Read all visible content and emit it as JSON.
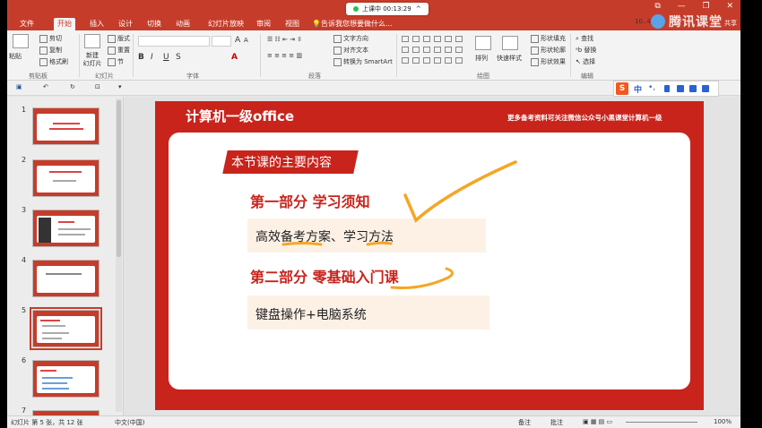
{
  "tabs": [
    "文件",
    "开始",
    "插入",
    "设计",
    "切换",
    "动画",
    "幻灯片放映",
    "审阅",
    "视图"
  ],
  "tell_me": "告诉我您想要做什么...",
  "recording": {
    "label": "上课中 00:13:29",
    "chevron": "^"
  },
  "window_controls": [
    "⧉",
    "—",
    "❐",
    "✕"
  ],
  "share_label": "共享",
  "tencent": {
    "brand": "腾讯课堂",
    "account": "10..41"
  },
  "ribbon": {
    "clipboard": {
      "paste": "粘贴",
      "cut": "剪切",
      "copy": "复制",
      "format_painter": "格式刷",
      "group": "剪贴板"
    },
    "slides": {
      "new_slide": "新建\n幻灯片",
      "layout": "版式",
      "reset": "重置",
      "section": "节",
      "group": "幻灯片"
    },
    "font": {
      "bold": "B",
      "italic": "I",
      "underline": "U",
      "strike": "S",
      "group": "字体",
      "grow": "A",
      "shrink": "A"
    },
    "paragraph": {
      "text_direction": "文字方向",
      "align_text": "对齐文本",
      "smartart": "转换为 SmartArt",
      "group": "段落"
    },
    "drawing": {
      "arrange": "排列",
      "quick_styles": "快速样式",
      "fill": "形状填充",
      "outline": "形状轮廓",
      "effects": "形状效果",
      "group": "绘图"
    },
    "editing": {
      "find": "查找",
      "replace": "替换",
      "select": "选择",
      "group": "编辑"
    }
  },
  "thumbnails": [
    {
      "num": "1",
      "selected": false
    },
    {
      "num": "2",
      "selected": false
    },
    {
      "num": "3",
      "selected": false
    },
    {
      "num": "4",
      "selected": false
    },
    {
      "num": "5",
      "selected": true
    },
    {
      "num": "6",
      "selected": false
    },
    {
      "num": "7",
      "selected": false
    }
  ],
  "slide": {
    "title": "计算机一级office",
    "note": "更多备考资料可关注微信公众号小黑课堂计算机一级",
    "tag": "本节课的主要内容",
    "part1": "第一部分  学习须知",
    "item1": "高效备考方案、学习方法",
    "part2": "第二部分  零基础入门课",
    "item2": "键盘操作+电脑系统"
  },
  "sogou": {
    "logo": "S",
    "mode": "中",
    "punct": "•,"
  },
  "status": {
    "slide_info": "幻灯片 第 5 张，共 12 张",
    "lang": "中文(中国)",
    "notes": "备注",
    "comments": "批注",
    "zoom": "100%"
  },
  "colors": {
    "brand_red": "#c63c2a",
    "slide_red": "#c8241c",
    "pen_orange": "#f5a623"
  }
}
